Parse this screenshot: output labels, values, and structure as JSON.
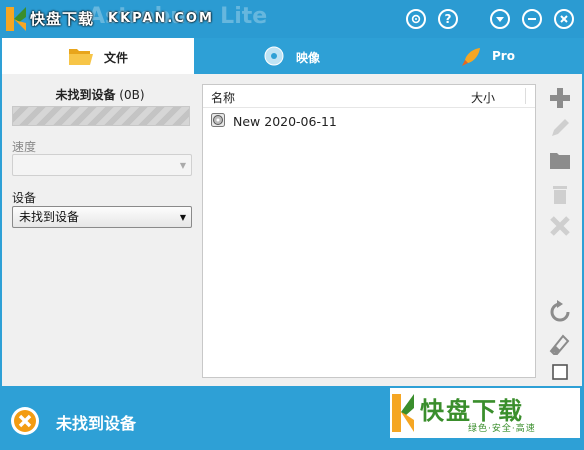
{
  "window": {
    "app_title": "Astroburn Lite",
    "watermark_text": "快盘下载",
    "watermark_url": "KKPAN.COM",
    "buttons": [
      "settings-icon",
      "help-icon",
      "dropdown-icon",
      "minimize-icon",
      "close-icon"
    ],
    "help_glyph": "?"
  },
  "tabs": [
    {
      "label": "文件",
      "icon": "folder-icon",
      "active": true
    },
    {
      "label": "映像",
      "icon": "disc-icon",
      "active": false
    },
    {
      "label": "Pro",
      "icon": "rocket-icon",
      "active": false
    }
  ],
  "device": {
    "title_main": "未找到设备",
    "title_size": "(0B)",
    "speed_label": "速度",
    "speed_value": "",
    "device_label": "设备",
    "device_value": "未找到设备"
  },
  "filelist": {
    "columns": [
      "名称",
      "大小"
    ],
    "rows": [
      {
        "name": "New 2020-06-11",
        "size": ""
      }
    ]
  },
  "toolbar": [
    "add-icon",
    "edit-icon",
    "folder-icon",
    "trash-icon",
    "delete-icon",
    "refresh-icon",
    "eraser-icon",
    "checkbox-icon"
  ],
  "status": {
    "text": "未找到设备",
    "icon": "error-icon"
  },
  "badge": {
    "title": "快盘下载",
    "subtitle": "绿色·安全·高速"
  },
  "colors": {
    "accent": "#2ea0d6",
    "error": "#f39c12",
    "badge_green": "#3a8e2c"
  }
}
